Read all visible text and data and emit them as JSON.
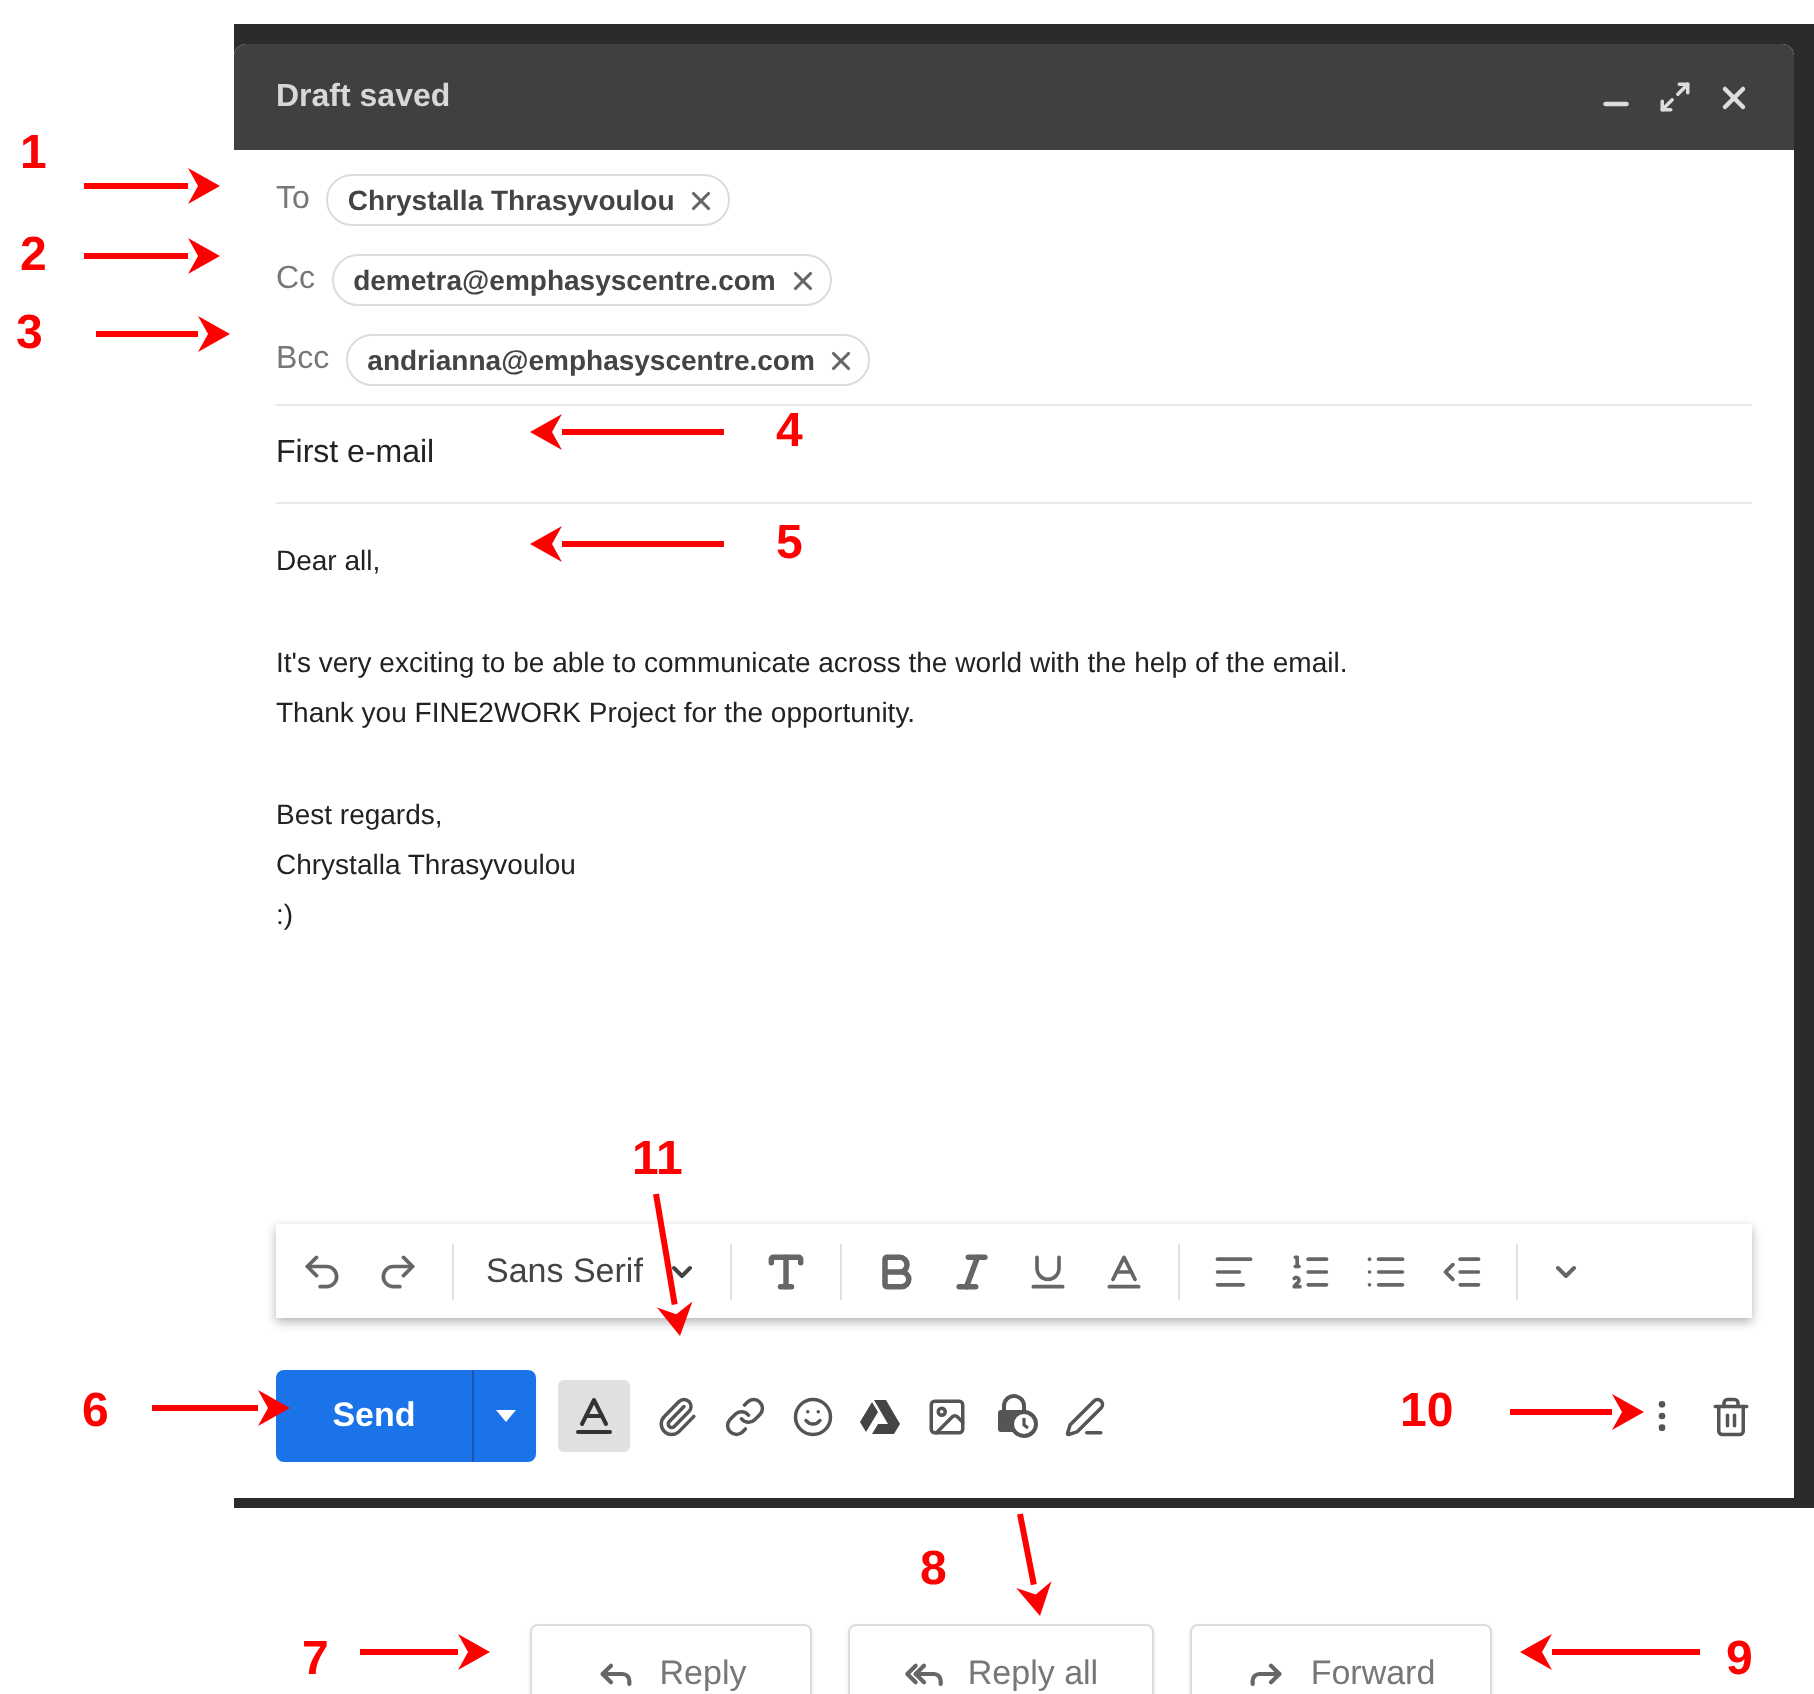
{
  "window": {
    "title": "Draft saved"
  },
  "recipients": [
    {
      "label": "To",
      "chips": [
        "Chrystalla Thrasyvoulou"
      ]
    },
    {
      "label": "Cc",
      "chips": [
        "demetra@emphasyscentre.com"
      ]
    },
    {
      "label": "Bcc",
      "chips": [
        "andrianna@emphasyscentre.com"
      ]
    }
  ],
  "subject": "First e-mail",
  "body": [
    [
      "Dear all,"
    ],
    [
      "It's very exciting to be able to communicate across the world with the help of the email.",
      "Thank you FINE2WORK Project for the opportunity."
    ],
    [
      "Best regards,",
      "Chrystalla Thrasyvoulou",
      ":)"
    ]
  ],
  "format_toolbar": {
    "font": "Sans Serif"
  },
  "send_bar": {
    "send_label": "Send",
    "formatting_selected": true
  },
  "actions": [
    {
      "label": "Reply",
      "kind": "reply"
    },
    {
      "label": "Reply all",
      "kind": "reply_all"
    },
    {
      "label": "Forward",
      "kind": "forward"
    }
  ],
  "annotations": [
    {
      "label": "1"
    },
    {
      "label": "2"
    },
    {
      "label": "3"
    },
    {
      "label": "4"
    },
    {
      "label": "5"
    },
    {
      "label": "6"
    },
    {
      "label": "7"
    },
    {
      "label": "8"
    },
    {
      "label": "9"
    },
    {
      "label": "10"
    },
    {
      "label": "11"
    }
  ]
}
